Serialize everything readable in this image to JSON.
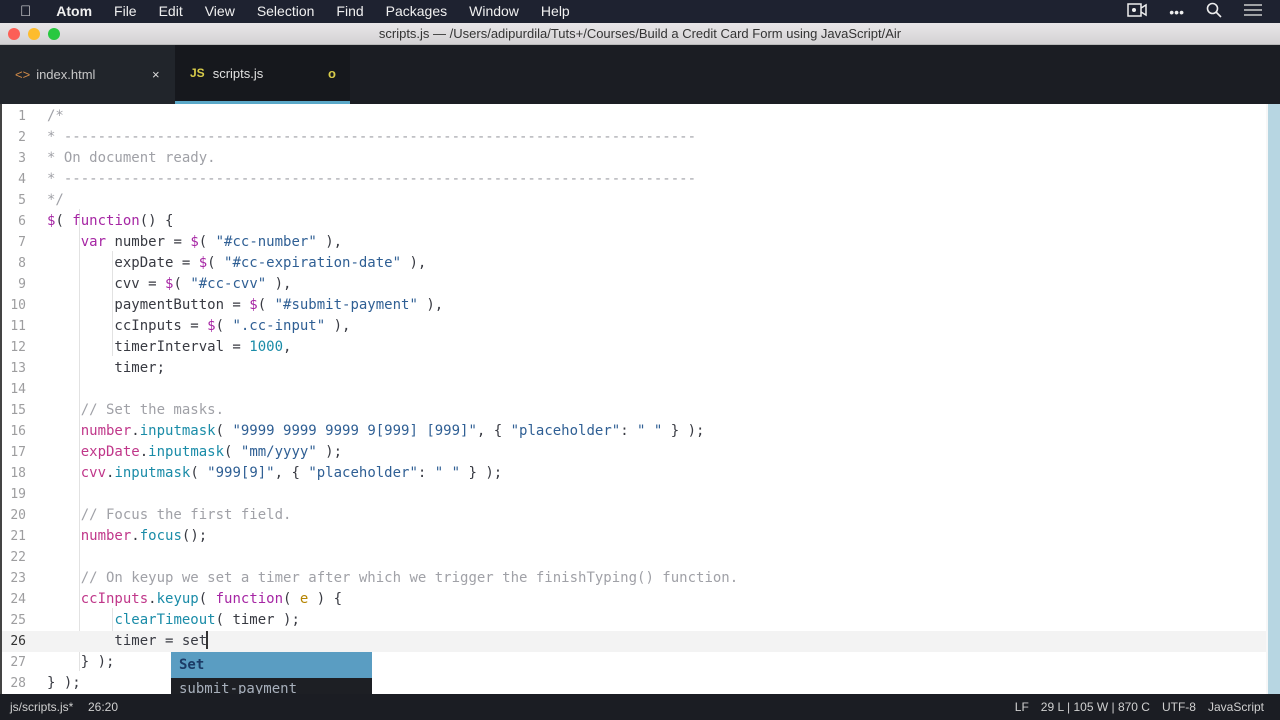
{
  "menubar": {
    "apple_icon": "apple-logo",
    "items": [
      "Atom",
      "File",
      "Edit",
      "View",
      "Selection",
      "Find",
      "Packages",
      "Window",
      "Help"
    ],
    "right_icons": [
      "camera-icon",
      "more-icon",
      "search-icon",
      "list-icon"
    ]
  },
  "window": {
    "title": "scripts.js — /Users/adipurdila/Tuts+/Courses/Build a Credit Card Form using JavaScript/Air"
  },
  "tabs": [
    {
      "label": "index.html",
      "icon": "<>",
      "close": "×"
    },
    {
      "label": "scripts.js",
      "icon": "JS",
      "modified": "o"
    }
  ],
  "editor": {
    "current_line": 26,
    "lines": [
      [
        [
          "c",
          "/*"
        ]
      ],
      [
        [
          "c",
          "* ---------------------------------------------------------------------------"
        ]
      ],
      [
        [
          "c",
          "* On document ready."
        ]
      ],
      [
        [
          "c",
          "* ---------------------------------------------------------------------------"
        ]
      ],
      [
        [
          "c",
          "*/"
        ]
      ],
      [
        [
          "k",
          "$"
        ],
        [
          "p",
          "( "
        ],
        [
          "k",
          "function"
        ],
        [
          "p",
          "() {"
        ]
      ],
      [
        [
          "p",
          "    "
        ],
        [
          "k",
          "var"
        ],
        [
          "p",
          " number = "
        ],
        [
          "k",
          "$"
        ],
        [
          "p",
          "( "
        ],
        [
          "s",
          "\"#cc-number\""
        ],
        [
          "p",
          " ),"
        ]
      ],
      [
        [
          "p",
          "        expDate = "
        ],
        [
          "k",
          "$"
        ],
        [
          "p",
          "( "
        ],
        [
          "s",
          "\"#cc-expiration-date\""
        ],
        [
          "p",
          " ),"
        ]
      ],
      [
        [
          "p",
          "        cvv = "
        ],
        [
          "k",
          "$"
        ],
        [
          "p",
          "( "
        ],
        [
          "s",
          "\"#cc-cvv\""
        ],
        [
          "p",
          " ),"
        ]
      ],
      [
        [
          "p",
          "        paymentButton = "
        ],
        [
          "k",
          "$"
        ],
        [
          "p",
          "( "
        ],
        [
          "s",
          "\"#submit-payment\""
        ],
        [
          "p",
          " ),"
        ]
      ],
      [
        [
          "p",
          "        ccInputs = "
        ],
        [
          "k",
          "$"
        ],
        [
          "p",
          "( "
        ],
        [
          "s",
          "\".cc-input\""
        ],
        [
          "p",
          " ),"
        ]
      ],
      [
        [
          "p",
          "        timerInterval = "
        ],
        [
          "n",
          "1000"
        ],
        [
          "p",
          ","
        ]
      ],
      [
        [
          "p",
          "        timer;"
        ]
      ],
      [],
      [
        [
          "p",
          "    "
        ],
        [
          "c",
          "// Set the masks."
        ]
      ],
      [
        [
          "p",
          "    "
        ],
        [
          "v",
          "number"
        ],
        [
          "p",
          "."
        ],
        [
          "f",
          "inputmask"
        ],
        [
          "p",
          "( "
        ],
        [
          "s",
          "\"9999 9999 9999 9[999] [999]\""
        ],
        [
          "p",
          ", { "
        ],
        [
          "s",
          "\"placeholder\""
        ],
        [
          "p",
          ": "
        ],
        [
          "s",
          "\" \""
        ],
        [
          "p",
          " } );"
        ]
      ],
      [
        [
          "p",
          "    "
        ],
        [
          "v",
          "expDate"
        ],
        [
          "p",
          "."
        ],
        [
          "f",
          "inputmask"
        ],
        [
          "p",
          "( "
        ],
        [
          "s",
          "\"mm/yyyy\""
        ],
        [
          "p",
          " );"
        ]
      ],
      [
        [
          "p",
          "    "
        ],
        [
          "v",
          "cvv"
        ],
        [
          "p",
          "."
        ],
        [
          "f",
          "inputmask"
        ],
        [
          "p",
          "( "
        ],
        [
          "s",
          "\"999[9]\""
        ],
        [
          "p",
          ", { "
        ],
        [
          "s",
          "\"placeholder\""
        ],
        [
          "p",
          ": "
        ],
        [
          "s",
          "\" \""
        ],
        [
          "p",
          " } );"
        ]
      ],
      [],
      [
        [
          "p",
          "    "
        ],
        [
          "c",
          "// Focus the first field."
        ]
      ],
      [
        [
          "p",
          "    "
        ],
        [
          "v",
          "number"
        ],
        [
          "p",
          "."
        ],
        [
          "f",
          "focus"
        ],
        [
          "p",
          "();"
        ]
      ],
      [],
      [
        [
          "p",
          "    "
        ],
        [
          "c",
          "// On keyup we set a timer after which we trigger the finishTyping() function."
        ]
      ],
      [
        [
          "p",
          "    "
        ],
        [
          "v",
          "ccInputs"
        ],
        [
          "p",
          "."
        ],
        [
          "f",
          "keyup"
        ],
        [
          "p",
          "( "
        ],
        [
          "k",
          "function"
        ],
        [
          "p",
          "( "
        ],
        [
          "e",
          "e"
        ],
        [
          "p",
          " ) {"
        ]
      ],
      [
        [
          "p",
          "        "
        ],
        [
          "f",
          "clearTimeout"
        ],
        [
          "p",
          "( timer );"
        ]
      ],
      [
        [
          "p",
          "        timer = set"
        ]
      ],
      [
        [
          "p",
          "    } );"
        ]
      ],
      [
        [
          "p",
          "} );"
        ]
      ]
    ]
  },
  "autocomplete": {
    "items": [
      "Set",
      "submit-payment"
    ]
  },
  "status": {
    "file": "js/scripts.js*",
    "cursor": "26:20",
    "line_ending": "LF",
    "counts": "29 L | 105 W | 870 C",
    "encoding": "UTF-8",
    "grammar": "JavaScript"
  }
}
